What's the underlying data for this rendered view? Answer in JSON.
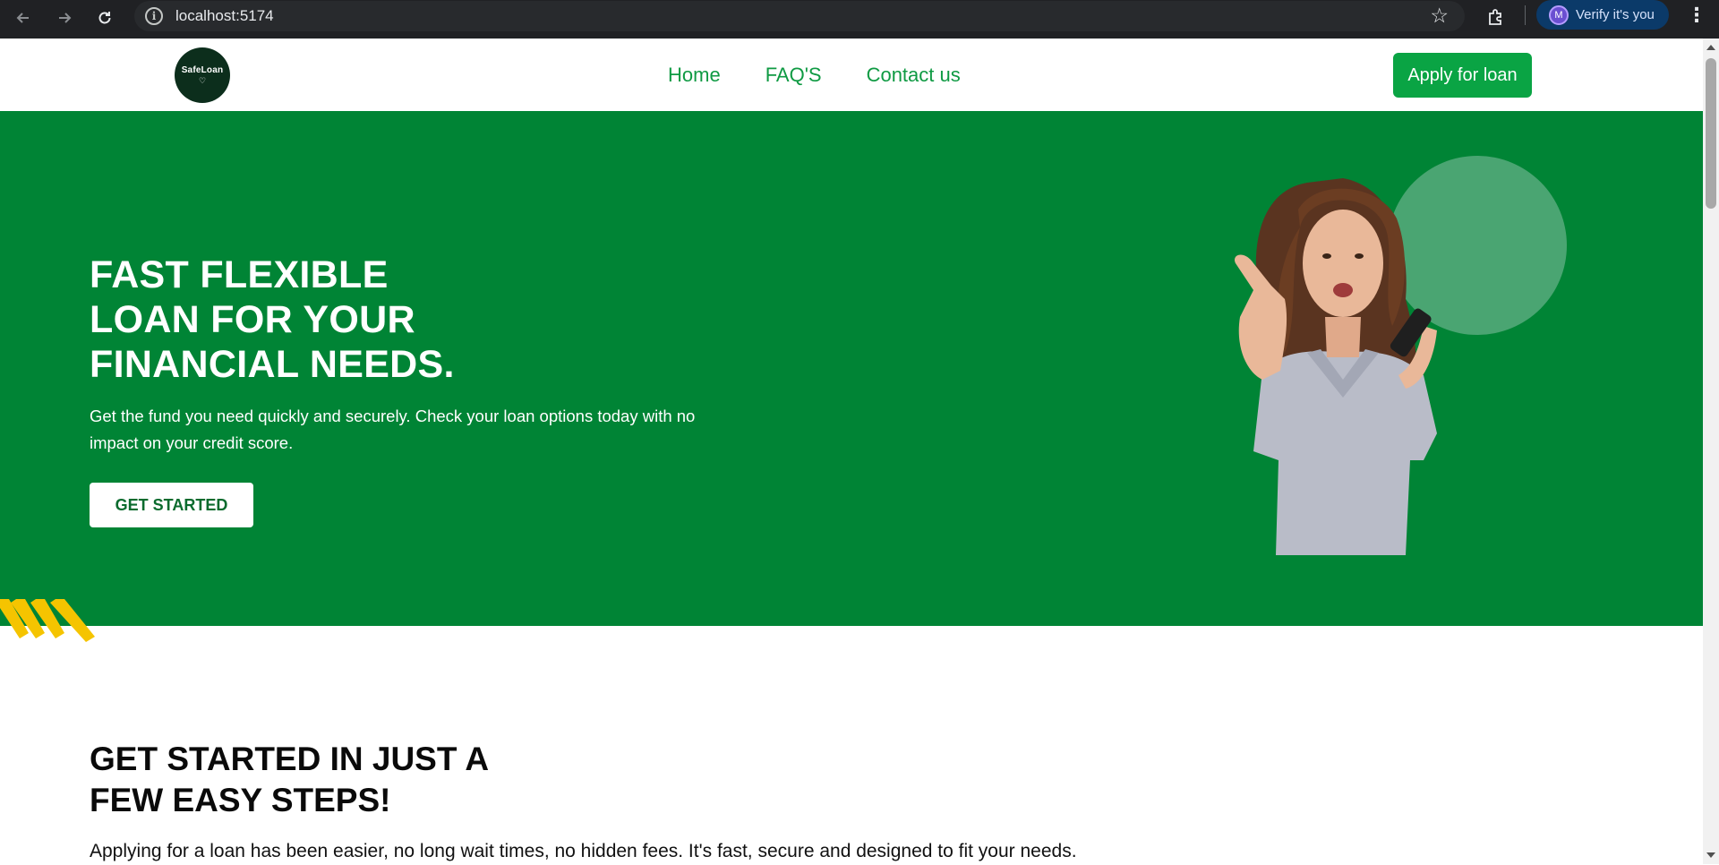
{
  "browser": {
    "url": "localhost:5174",
    "profile_initial": "M",
    "verify_label": "Verify it's you",
    "icons": [
      "back-icon",
      "forward-icon",
      "reload-icon",
      "info-icon",
      "star-icon",
      "extensions-icon",
      "kebab-menu-icon"
    ]
  },
  "header": {
    "logo_text": "SafeLoan",
    "nav": [
      {
        "label": "Home"
      },
      {
        "label": "FAQ'S"
      },
      {
        "label": "Contact us"
      }
    ],
    "cta_label": "Apply for loan"
  },
  "hero": {
    "title_lines": [
      "FAST FLEXIBLE",
      "LOAN FOR YOUR",
      "FINANCIAL NEEDS."
    ],
    "subtitle": "Get the fund you need quickly and securely. Check your loan options today with no impact on your credit score.",
    "button_label": "GET STARTED"
  },
  "steps": {
    "title_lines": [
      "GET STARTED IN JUST A",
      "FEW EASY STEPS!"
    ],
    "text": "Applying for a loan has been easier, no long wait times, no hidden fees. It's fast, secure and designed to fit your needs."
  },
  "colors": {
    "brand_green": "#008435",
    "nav_green": "#0f9a43",
    "cta_green": "#0aa444",
    "accent_yellow": "#f5c400",
    "logo_bg": "#0c2e1c"
  }
}
